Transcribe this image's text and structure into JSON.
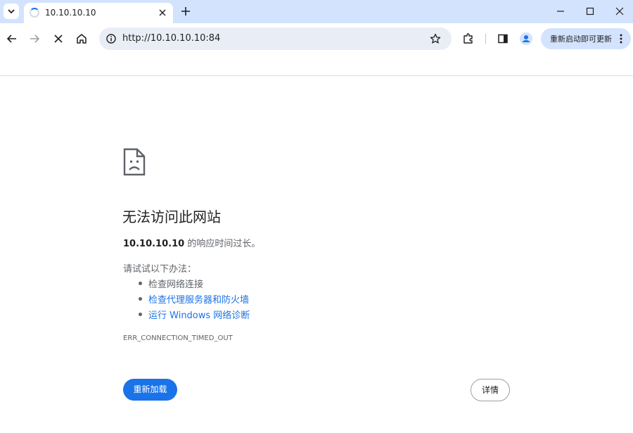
{
  "browser": {
    "tab": {
      "title": "10.10.10.10"
    },
    "toolbar": {
      "url": "http://10.10.10.10:84",
      "update_label": "重新启动即可更新"
    }
  },
  "error_page": {
    "heading": "无法访问此网站",
    "host": "10.10.10.10",
    "summary_suffix": " 的响应时间过长。",
    "suggestions_title": "请试试以下办法：",
    "suggestions": [
      {
        "label": "检查网络连接",
        "is_link": false
      },
      {
        "label": "检查代理服务器和防火墙",
        "is_link": true
      },
      {
        "label": "运行 Windows 网络诊断",
        "is_link": true
      }
    ],
    "error_code": "ERR_CONNECTION_TIMED_OUT",
    "reload_label": "重新加载",
    "details_label": "详情"
  },
  "colors": {
    "accent": "#1a73e8",
    "tabstrip": "#d3e3fd",
    "omnibox": "#e9eef6"
  },
  "icons": [
    "chevron-down-icon",
    "loading-spinner-icon",
    "close-icon",
    "plus-icon",
    "minimize-icon",
    "maximize-icon",
    "back-icon",
    "forward-icon",
    "stop-icon",
    "home-icon",
    "info-icon",
    "star-icon",
    "extensions-icon",
    "side-panel-icon",
    "profile-icon",
    "more-vert-icon",
    "sad-page-icon"
  ]
}
